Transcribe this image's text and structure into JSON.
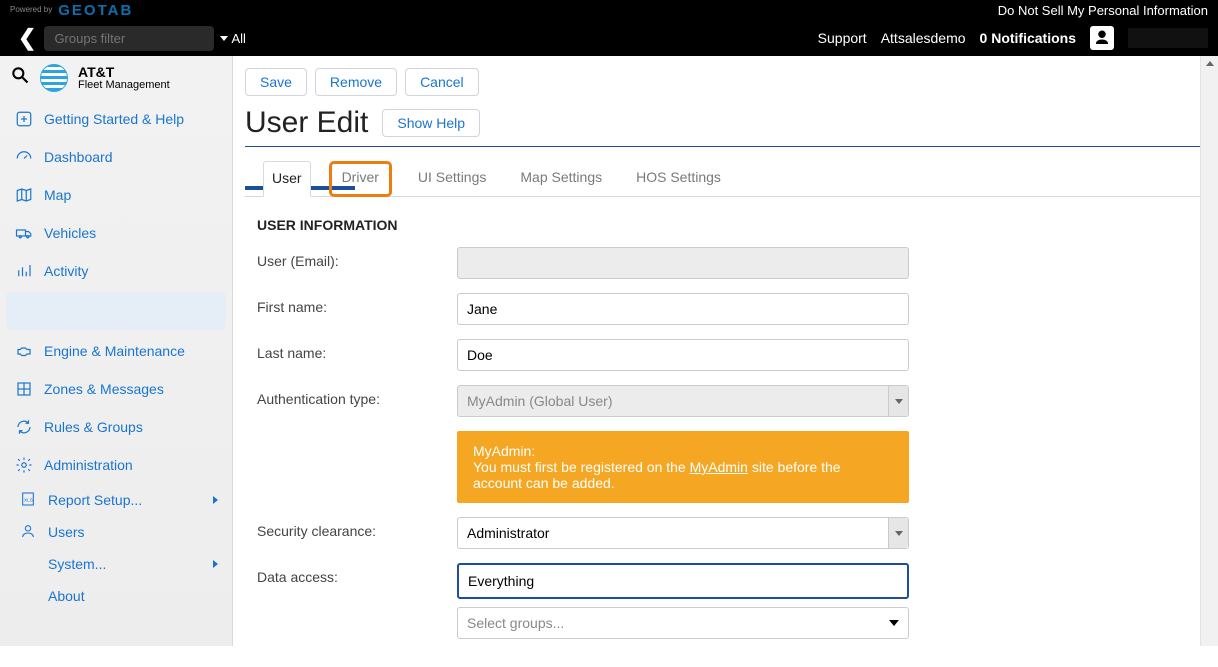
{
  "top": {
    "powered": "Powered by",
    "geo": "GEOTAB",
    "dns": "Do Not Sell My Personal Information",
    "groups_placeholder": "Groups filter",
    "all": "All",
    "support": "Support",
    "account": "Attsalesdemo",
    "notifications": "0 Notifications"
  },
  "brand": {
    "l1": "AT&T",
    "l2": "Fleet Management"
  },
  "sidebar": {
    "items": [
      "Getting Started & Help",
      "Dashboard",
      "Map",
      "Vehicles",
      "Activity",
      "Engine & Maintenance",
      "Zones & Messages",
      "Rules & Groups",
      "Administration"
    ],
    "subs": [
      "Report Setup...",
      "Users",
      "System...",
      "About"
    ]
  },
  "actions": {
    "save": "Save",
    "remove": "Remove",
    "cancel": "Cancel"
  },
  "page": {
    "title": "User Edit",
    "showHelp": "Show Help"
  },
  "tabs": [
    "User",
    "Driver",
    "UI Settings",
    "Map Settings",
    "HOS Settings"
  ],
  "form": {
    "section": "USER INFORMATION",
    "labels": {
      "user": "User (Email):",
      "first": "First name:",
      "last": "Last name:",
      "auth": "Authentication type:",
      "sec": "Security clearance:",
      "data": "Data access:"
    },
    "values": {
      "user": "",
      "first": "Jane",
      "last": "Doe",
      "auth": "MyAdmin (Global User)",
      "sec": "Administrator",
      "data": "Everything",
      "select_groups": "Select groups..."
    },
    "alert": {
      "t1": "MyAdmin:",
      "t2a": "You must first be registered on the ",
      "link": "MyAdmin",
      "t2b": " site before the account can be added."
    }
  }
}
